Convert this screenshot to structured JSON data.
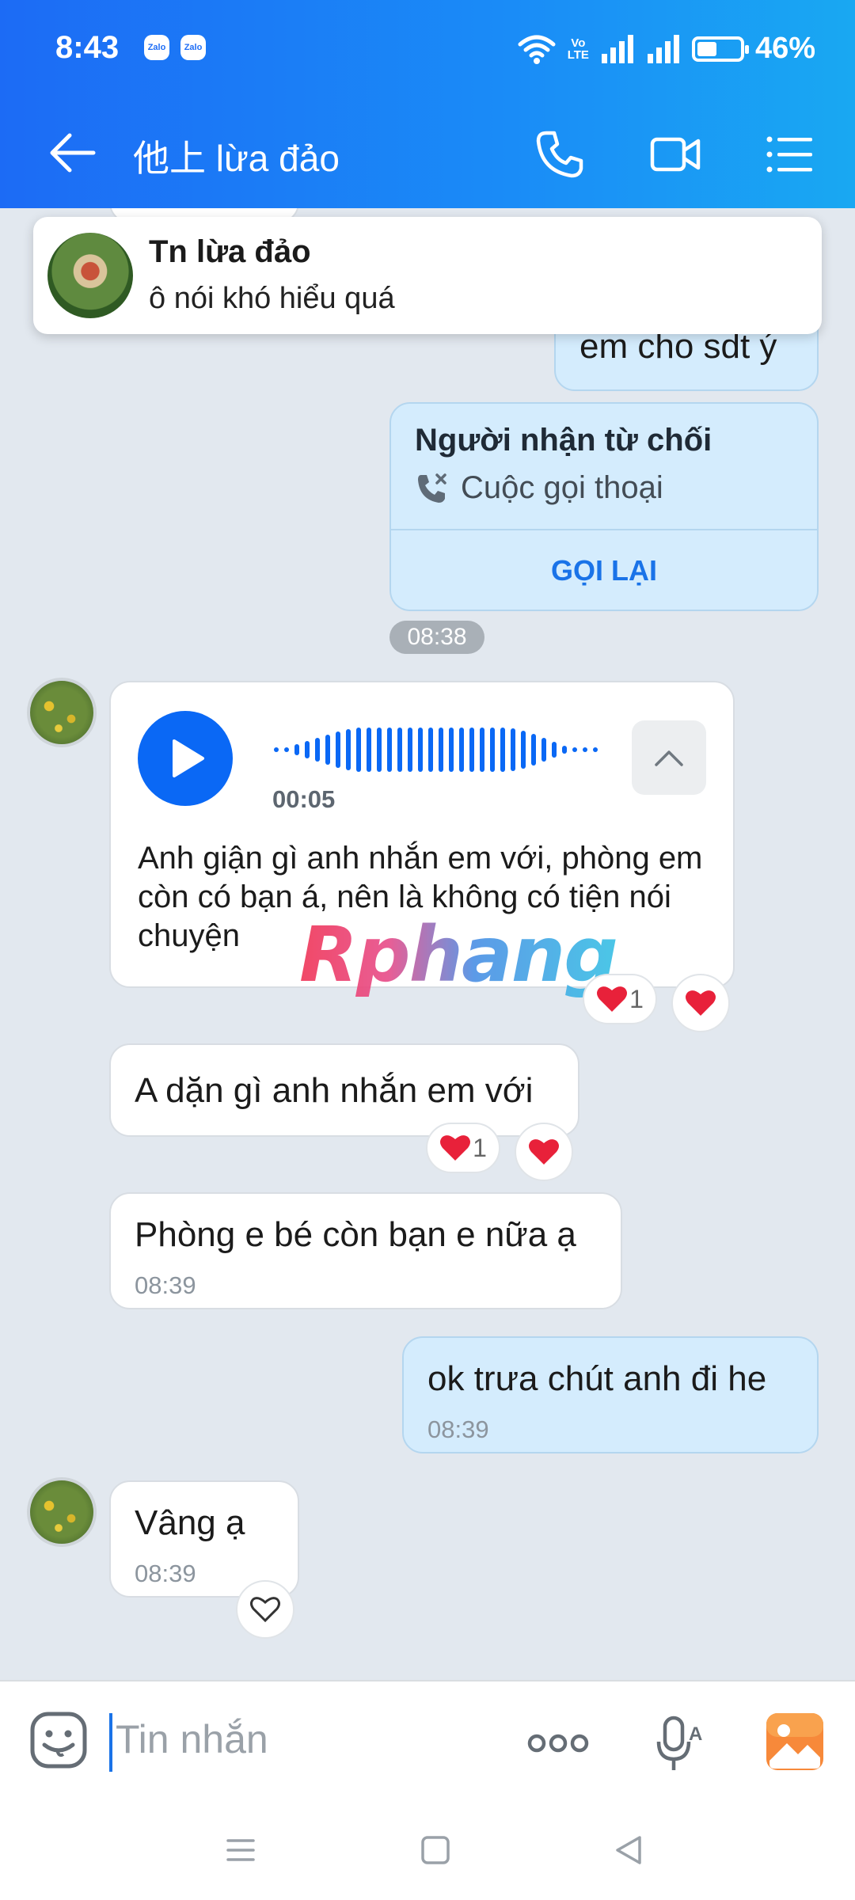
{
  "status_bar": {
    "time": "8:43",
    "app_badges": [
      "Zalo",
      "Zalo"
    ],
    "network": "Vo LTE",
    "battery": "46%",
    "battery_level": 0.46
  },
  "header": {
    "title": "他上 lừa đảo",
    "icons": [
      "back-arrow-icon",
      "phone-call-icon",
      "video-call-icon",
      "menu-list-icon"
    ]
  },
  "notification": {
    "sender": "Tn lừa đảo",
    "message": "ô nói khó hiểu quá"
  },
  "messages": {
    "partial_sent": {
      "text": "em cho sdt ý"
    },
    "missed_call": {
      "title": "Người nhận từ chối",
      "subtitle": "Cuộc gọi thoại",
      "action": "GỌI LẠI"
    },
    "divider_time": "08:38",
    "voice": {
      "duration": "00:05",
      "transcript": "Anh giận gì anh nhắn em với, phòng em còn có bạn á, nên là không có tiện nói chuyện",
      "reaction_count": "1"
    },
    "m1": {
      "text": "A dặn gì anh nhắn em với",
      "reaction_count": "1"
    },
    "m2": {
      "text": "Phòng e bé còn bạn e nữa ạ",
      "time": "08:39"
    },
    "m3": {
      "text": "ok trưa chút anh đi he",
      "time": "08:39"
    },
    "m4": {
      "text": "Vâng ạ",
      "time": "08:39"
    }
  },
  "watermark": "Rphang",
  "composer": {
    "placeholder": "Tin nhắn",
    "icons": [
      "emoji-icon",
      "more-dots-icon",
      "voice-to-text-icon",
      "image-gallery-icon"
    ]
  },
  "navbar": {
    "icons": [
      "recent-apps-icon",
      "home-icon",
      "back-icon"
    ]
  },
  "colors": {
    "header_start": "#1c6bf5",
    "header_end": "#19a8f2",
    "sent_bubble": "#d4ecfd",
    "accent": "#0a68f5",
    "chat_bg": "#e2e8ef",
    "heart": "#e8213a"
  }
}
